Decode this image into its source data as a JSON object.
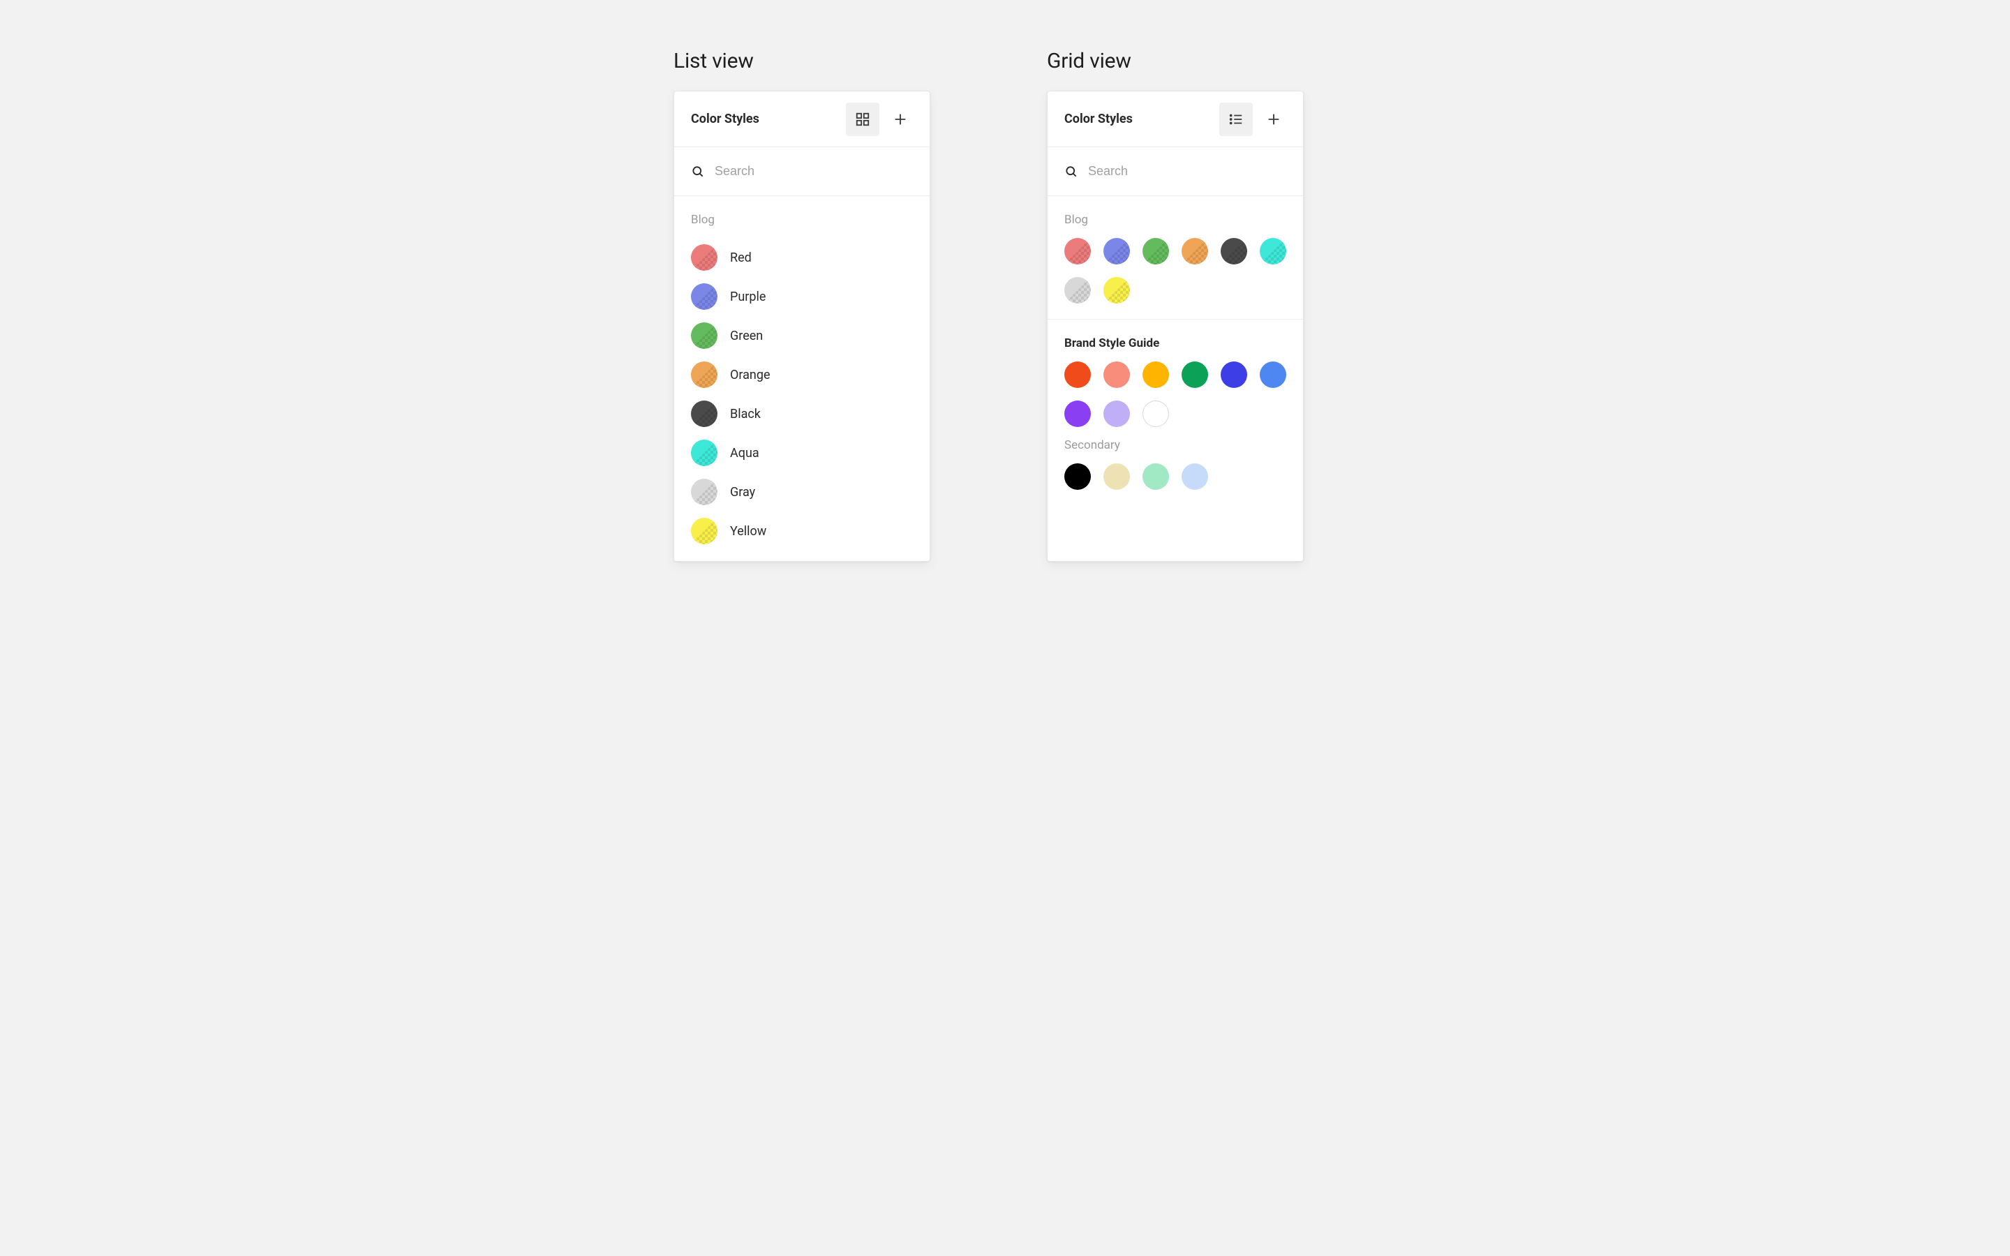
{
  "headings": {
    "list": "List view",
    "grid": "Grid view"
  },
  "panel": {
    "title": "Color Styles",
    "search_placeholder": "Search"
  },
  "list_panel": {
    "groups": [
      {
        "label": "Blog",
        "label_strong": false,
        "items": [
          {
            "name": "Red",
            "color": "#ec7b7b",
            "alpha": true
          },
          {
            "name": "Purple",
            "color": "#7a87e8",
            "alpha": true
          },
          {
            "name": "Green",
            "color": "#64bb5e",
            "alpha": true
          },
          {
            "name": "Orange",
            "color": "#f0a556",
            "alpha": true
          },
          {
            "name": "Black",
            "color": "#4a4a4a",
            "alpha": true
          },
          {
            "name": "Aqua",
            "color": "#3ee8d8",
            "alpha": true
          },
          {
            "name": "Gray",
            "color": "#d8d8d8",
            "alpha": true
          },
          {
            "name": "Yellow",
            "color": "#f8ef4a",
            "alpha": true
          }
        ]
      }
    ]
  },
  "grid_panel": {
    "groups": [
      {
        "label": "Blog",
        "label_strong": false,
        "colors": [
          {
            "color": "#ec7b7b",
            "alpha": true
          },
          {
            "color": "#7a87e8",
            "alpha": true
          },
          {
            "color": "#64bb5e",
            "alpha": true
          },
          {
            "color": "#f0a556",
            "alpha": true
          },
          {
            "color": "#4a4a4a",
            "alpha": true
          },
          {
            "color": "#3ee8d8",
            "alpha": true
          },
          {
            "color": "#d8d8d8",
            "alpha": true
          },
          {
            "color": "#f8ef4a",
            "alpha": true
          }
        ]
      },
      {
        "label": "Brand Style Guide",
        "label_strong": true,
        "colors": [
          {
            "color": "#f04b1a",
            "alpha": false
          },
          {
            "color": "#f98d7c",
            "alpha": false
          },
          {
            "color": "#ffb400",
            "alpha": false
          },
          {
            "color": "#0ba157",
            "alpha": false
          },
          {
            "color": "#3e3ee6",
            "alpha": false
          },
          {
            "color": "#4f87f2",
            "alpha": false
          },
          {
            "color": "#8a3ff2",
            "alpha": false
          },
          {
            "color": "#c0aef7",
            "alpha": false
          },
          {
            "color": "#ffffff",
            "alpha": false,
            "white": true
          }
        ],
        "subsections": [
          {
            "label": "Secondary",
            "colors": [
              {
                "color": "#000000",
                "alpha": false
              },
              {
                "color": "#eee2b5",
                "alpha": false
              },
              {
                "color": "#a1e8c4",
                "alpha": false
              },
              {
                "color": "#c6dbf9",
                "alpha": false
              }
            ]
          }
        ]
      }
    ]
  }
}
